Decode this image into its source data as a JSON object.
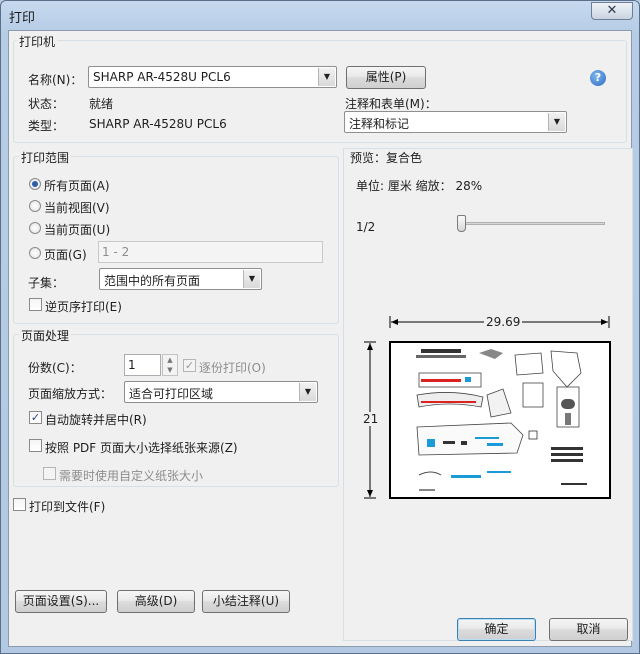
{
  "window": {
    "title": "打印",
    "close_glyph": "✕"
  },
  "printer": {
    "group_title": "打印机",
    "name_label": "名称(N)：",
    "name_value": "SHARP AR-4528U PCL6",
    "properties_button": "属性(P)",
    "status_label": "状态：",
    "status_value": "就绪",
    "type_label": "类型：",
    "type_value": "SHARP AR-4528U PCL6",
    "comments_label": "注释和表单(M)：",
    "comments_value": "注释和标记",
    "help_glyph": "?"
  },
  "range": {
    "group_title": "打印范围",
    "options": [
      "所有页面(A)",
      "当前视图(V)",
      "当前页面(U)",
      "页面(G)"
    ],
    "selected_index": 0,
    "pages_placeholder": "1 - 2",
    "subset_label": "子集：",
    "subset_value": "范围中的所有页面",
    "reverse_label": "逆页序打印(E)",
    "reverse_checked": false
  },
  "handling": {
    "group_title": "页面处理",
    "copies_label": "份数(C)：",
    "copies_value": "1",
    "collate_label": "逐份打印(O)",
    "collate_checked": true,
    "scaling_label": "页面缩放方式：",
    "scaling_value": "适合可打印区域",
    "autorotate_label": "自动旋转并居中(R)",
    "autorotate_checked": true,
    "pdf_source_label": "按照 PDF 页面大小选择纸张来源(Z)",
    "pdf_source_checked": false,
    "custom_paper_label": "需要时使用自定义纸张大小",
    "custom_paper_checked": false
  },
  "print_to_file": {
    "label": "打印到文件(F)",
    "checked": false
  },
  "preview": {
    "title": "预览：复合色",
    "units_text": "单位: 厘米 缩放： 28%",
    "page_indicator": "1/2",
    "page_position": 0.0,
    "width_dim": "29.69",
    "height_dim": "21"
  },
  "buttons": {
    "page_setup": "页面设置(S)...",
    "advanced": "高级(D)",
    "summarize": "小结注释(U)",
    "ok": "确定",
    "cancel": "取消"
  },
  "colors": {
    "accent": "#2b5fa8",
    "titlebar": "#c6d9ee"
  }
}
